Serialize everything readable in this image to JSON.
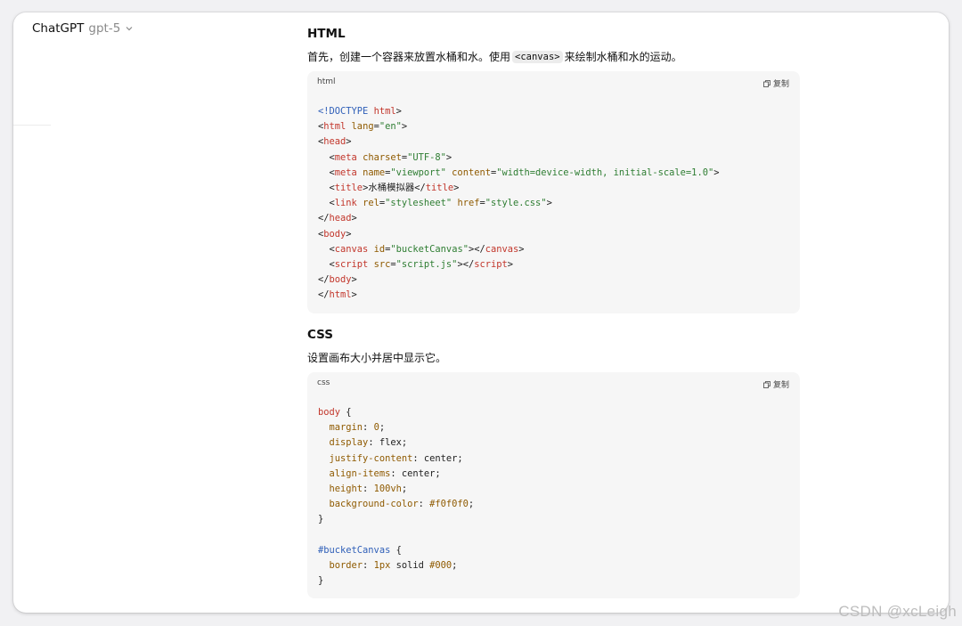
{
  "header": {
    "app_name": "ChatGPT",
    "model": "gpt-5",
    "chevron_icon": "chevron-down-icon"
  },
  "sections": [
    {
      "heading": "HTML",
      "intro_before": "首先，创建一个容器来放置水桶和水。使用",
      "intro_code": "<canvas>",
      "intro_after": "来绘制水桶和水的运动。",
      "code_lang": "html",
      "copy_label": "复制",
      "code_lines": [
        [
          {
            "t": "<!DOCTYPE",
            "c": "doc"
          },
          {
            "t": " html",
            "c": "tag"
          },
          {
            "t": ">",
            "c": "plain"
          }
        ],
        [
          {
            "t": "<",
            "c": "plain"
          },
          {
            "t": "html",
            "c": "tag"
          },
          {
            "t": " lang",
            "c": "attr"
          },
          {
            "t": "=",
            "c": "plain"
          },
          {
            "t": "\"en\"",
            "c": "str"
          },
          {
            "t": ">",
            "c": "plain"
          }
        ],
        [
          {
            "t": "<",
            "c": "plain"
          },
          {
            "t": "head",
            "c": "tag"
          },
          {
            "t": ">",
            "c": "plain"
          }
        ],
        [
          {
            "t": "  <",
            "c": "plain"
          },
          {
            "t": "meta",
            "c": "tag"
          },
          {
            "t": " charset",
            "c": "attr"
          },
          {
            "t": "=",
            "c": "plain"
          },
          {
            "t": "\"UTF-8\"",
            "c": "str"
          },
          {
            "t": ">",
            "c": "plain"
          }
        ],
        [
          {
            "t": "  <",
            "c": "plain"
          },
          {
            "t": "meta",
            "c": "tag"
          },
          {
            "t": " name",
            "c": "attr"
          },
          {
            "t": "=",
            "c": "plain"
          },
          {
            "t": "\"viewport\"",
            "c": "str"
          },
          {
            "t": " content",
            "c": "attr"
          },
          {
            "t": "=",
            "c": "plain"
          },
          {
            "t": "\"width=device-width, initial-scale=1.0\"",
            "c": "str"
          },
          {
            "t": ">",
            "c": "plain"
          }
        ],
        [
          {
            "t": "  <",
            "c": "plain"
          },
          {
            "t": "title",
            "c": "tag"
          },
          {
            "t": ">水桶模拟器</",
            "c": "plain"
          },
          {
            "t": "title",
            "c": "tag"
          },
          {
            "t": ">",
            "c": "plain"
          }
        ],
        [
          {
            "t": "  <",
            "c": "plain"
          },
          {
            "t": "link",
            "c": "tag"
          },
          {
            "t": " rel",
            "c": "attr"
          },
          {
            "t": "=",
            "c": "plain"
          },
          {
            "t": "\"stylesheet\"",
            "c": "str"
          },
          {
            "t": " href",
            "c": "attr"
          },
          {
            "t": "=",
            "c": "plain"
          },
          {
            "t": "\"style.css\"",
            "c": "str"
          },
          {
            "t": ">",
            "c": "plain"
          }
        ],
        [
          {
            "t": "</",
            "c": "plain"
          },
          {
            "t": "head",
            "c": "tag"
          },
          {
            "t": ">",
            "c": "plain"
          }
        ],
        [
          {
            "t": "<",
            "c": "plain"
          },
          {
            "t": "body",
            "c": "tag"
          },
          {
            "t": ">",
            "c": "plain"
          }
        ],
        [
          {
            "t": "  <",
            "c": "plain"
          },
          {
            "t": "canvas",
            "c": "tag"
          },
          {
            "t": " id",
            "c": "attr"
          },
          {
            "t": "=",
            "c": "plain"
          },
          {
            "t": "\"bucketCanvas\"",
            "c": "str"
          },
          {
            "t": "></",
            "c": "plain"
          },
          {
            "t": "canvas",
            "c": "tag"
          },
          {
            "t": ">",
            "c": "plain"
          }
        ],
        [
          {
            "t": "  <",
            "c": "plain"
          },
          {
            "t": "script",
            "c": "tag"
          },
          {
            "t": " src",
            "c": "attr"
          },
          {
            "t": "=",
            "c": "plain"
          },
          {
            "t": "\"script.js\"",
            "c": "str"
          },
          {
            "t": "></",
            "c": "plain"
          },
          {
            "t": "script",
            "c": "tag"
          },
          {
            "t": ">",
            "c": "plain"
          }
        ],
        [
          {
            "t": "</",
            "c": "plain"
          },
          {
            "t": "body",
            "c": "tag"
          },
          {
            "t": ">",
            "c": "plain"
          }
        ],
        [
          {
            "t": "</",
            "c": "plain"
          },
          {
            "t": "html",
            "c": "tag"
          },
          {
            "t": ">",
            "c": "plain"
          }
        ]
      ]
    },
    {
      "heading": "CSS",
      "intro_before": "设置画布大小并居中显示它。",
      "code_lang": "css",
      "copy_label": "复制",
      "code_lines": [
        [
          {
            "t": "body",
            "c": "sel"
          },
          {
            "t": " {",
            "c": "plain"
          }
        ],
        [
          {
            "t": "  margin",
            "c": "prop"
          },
          {
            "t": ": ",
            "c": "plain"
          },
          {
            "t": "0",
            "c": "num"
          },
          {
            "t": ";",
            "c": "plain"
          }
        ],
        [
          {
            "t": "  display",
            "c": "prop"
          },
          {
            "t": ": flex;",
            "c": "plain"
          }
        ],
        [
          {
            "t": "  justify-content",
            "c": "prop"
          },
          {
            "t": ": center;",
            "c": "plain"
          }
        ],
        [
          {
            "t": "  align-items",
            "c": "prop"
          },
          {
            "t": ": center;",
            "c": "plain"
          }
        ],
        [
          {
            "t": "  height",
            "c": "prop"
          },
          {
            "t": ": ",
            "c": "plain"
          },
          {
            "t": "100vh",
            "c": "num"
          },
          {
            "t": ";",
            "c": "plain"
          }
        ],
        [
          {
            "t": "  background-color",
            "c": "prop"
          },
          {
            "t": ": ",
            "c": "plain"
          },
          {
            "t": "#f0f0f0",
            "c": "num"
          },
          {
            "t": ";",
            "c": "plain"
          }
        ],
        [
          {
            "t": "}",
            "c": "plain"
          }
        ],
        [],
        [
          {
            "t": "#bucketCanvas",
            "c": "id"
          },
          {
            "t": " {",
            "c": "plain"
          }
        ],
        [
          {
            "t": "  border",
            "c": "prop"
          },
          {
            "t": ": ",
            "c": "plain"
          },
          {
            "t": "1px",
            "c": "num"
          },
          {
            "t": " solid ",
            "c": "plain"
          },
          {
            "t": "#000",
            "c": "num"
          },
          {
            "t": ";",
            "c": "plain"
          }
        ],
        [
          {
            "t": "}",
            "c": "plain"
          }
        ]
      ]
    }
  ],
  "watermark": "CSDN @xcLeigh"
}
